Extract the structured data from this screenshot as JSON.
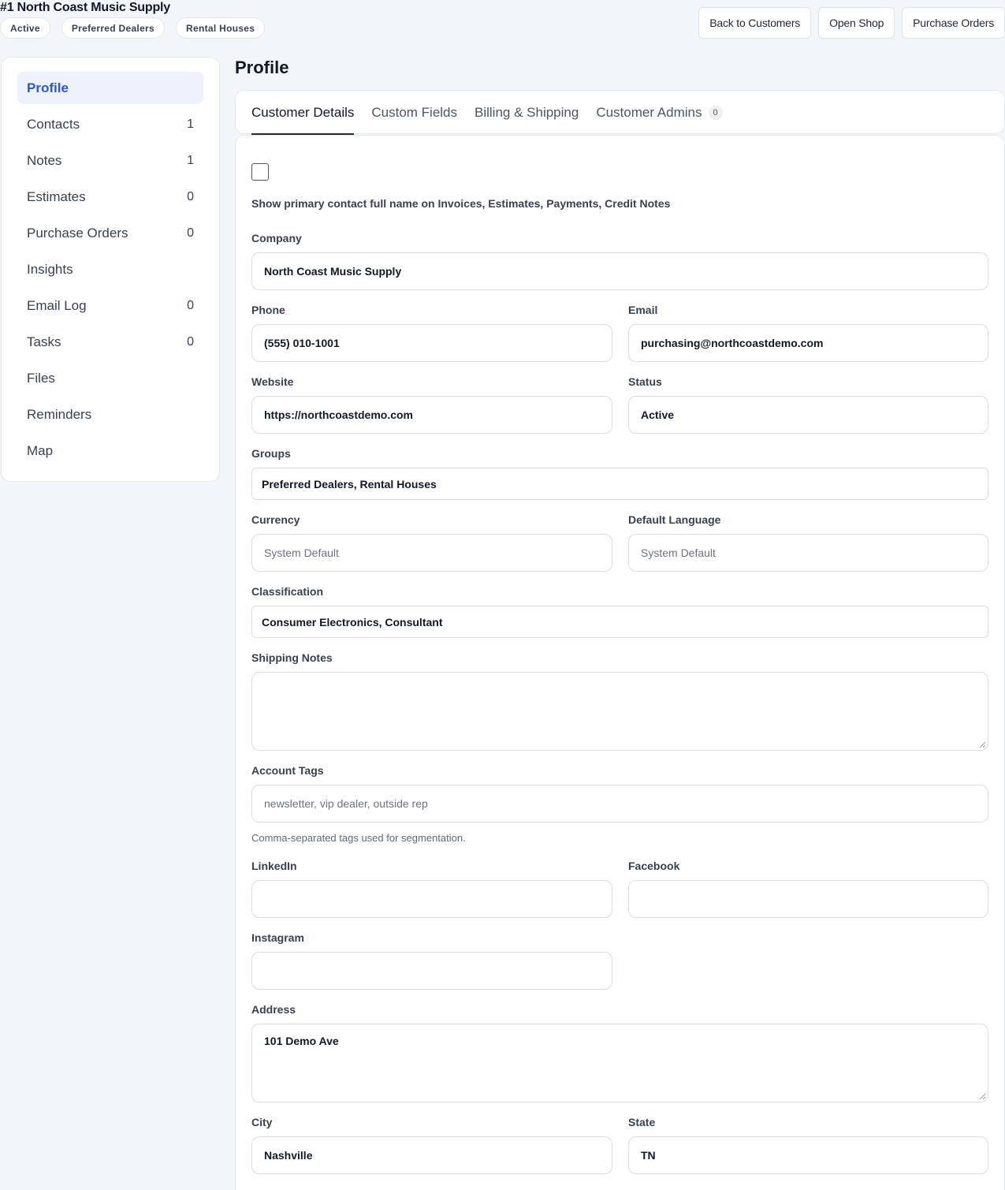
{
  "header": {
    "title": "#1 North Coast Music Supply",
    "badges": [
      "Active",
      "Preferred Dealers",
      "Rental Houses"
    ],
    "actions": {
      "back": "Back to Customers",
      "shop": "Open Shop",
      "purchase_orders": "Purchase Orders"
    }
  },
  "sidebar": {
    "items": [
      {
        "label": "Profile",
        "count": ""
      },
      {
        "label": "Contacts",
        "count": "1"
      },
      {
        "label": "Notes",
        "count": "1"
      },
      {
        "label": "Estimates",
        "count": "0"
      },
      {
        "label": "Purchase Orders",
        "count": "0"
      },
      {
        "label": "Insights",
        "count": ""
      },
      {
        "label": "Email Log",
        "count": "0"
      },
      {
        "label": "Tasks",
        "count": "0"
      },
      {
        "label": "Files",
        "count": ""
      },
      {
        "label": "Reminders",
        "count": ""
      },
      {
        "label": "Map",
        "count": ""
      }
    ]
  },
  "main": {
    "title": "Profile",
    "tabs": [
      {
        "label": "Customer Details"
      },
      {
        "label": "Custom Fields"
      },
      {
        "label": "Billing & Shipping"
      },
      {
        "label": "Customer Admins",
        "count": "0"
      }
    ]
  },
  "form": {
    "show_contact_label": "Show primary contact full name on Invoices, Estimates, Payments, Credit Notes",
    "company": {
      "label": "Company",
      "value": "North Coast Music Supply"
    },
    "phone": {
      "label": "Phone",
      "value": "(555) 010-1001"
    },
    "email": {
      "label": "Email",
      "value": "purchasing@northcoastdemo.com"
    },
    "website": {
      "label": "Website",
      "value": "https://northcoastdemo.com"
    },
    "status": {
      "label": "Status",
      "value": "Active"
    },
    "groups": {
      "label": "Groups",
      "value": "Preferred Dealers, Rental Houses"
    },
    "currency": {
      "label": "Currency",
      "value": "System Default"
    },
    "language": {
      "label": "Default Language",
      "value": "System Default"
    },
    "classification": {
      "label": "Classification",
      "value": "Consumer Electronics, Consultant"
    },
    "shipping_notes": {
      "label": "Shipping Notes",
      "value": ""
    },
    "account_tags": {
      "label": "Account Tags",
      "placeholder": "newsletter, vip dealer, outside rep",
      "help": "Comma-separated tags used for segmentation."
    },
    "linkedin": {
      "label": "LinkedIn",
      "value": ""
    },
    "facebook": {
      "label": "Facebook",
      "value": ""
    },
    "instagram": {
      "label": "Instagram",
      "value": ""
    },
    "address": {
      "label": "Address",
      "value": "101 Demo Ave"
    },
    "city": {
      "label": "City",
      "value": "Nashville"
    },
    "state": {
      "label": "State",
      "value": "TN"
    }
  }
}
